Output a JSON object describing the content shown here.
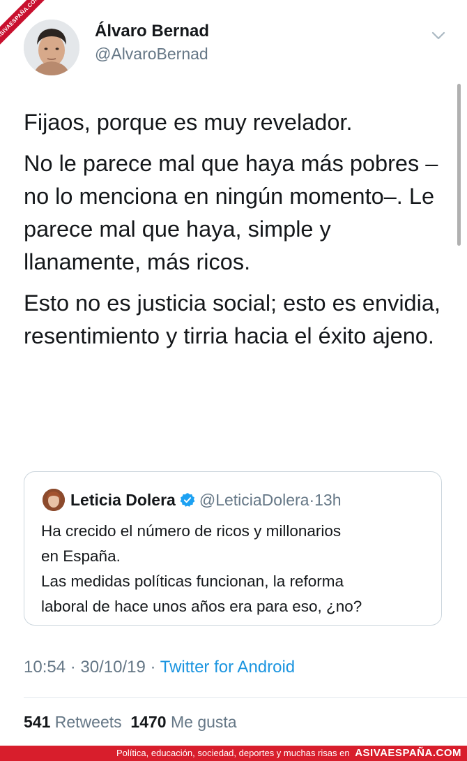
{
  "watermark": {
    "corner_text": "ASIVAESPAÑA.COM"
  },
  "tweet": {
    "author_name": "Álvaro Bernad",
    "author_handle": "@AlvaroBernad",
    "menu_icon": "chevron-down-icon",
    "paragraphs": [
      "Fijaos, porque es muy revelador.",
      "No le parece mal que haya más pobres – no lo menciona en ningún momento–. Le parece mal que haya, simple y llanamente, más ricos.",
      "Esto no es justicia social; esto es envidia, resentimiento y tirria hacia el éxito ajeno."
    ],
    "time": "10:54",
    "date": "30/10/19",
    "separator": "·",
    "source": "Twitter for Android",
    "retweets_count": "541",
    "retweets_label": "Retweets",
    "likes_count": "1470",
    "likes_label": "Me gusta"
  },
  "quoted": {
    "name": "Leticia Dolera",
    "verified_icon": "verified-badge-icon",
    "handle": "@LeticiaDolera",
    "separator": "·",
    "time": "13h",
    "lines": [
      "Ha crecido el número de ricos y  millonarios",
      "en España.",
      "Las medidas políticas funcionan, la reforma",
      "laboral de hace unos años era para eso, ¿no?"
    ]
  },
  "footer": {
    "tagline": "Política, educación, sociedad, deportes y muchas risas en",
    "site": "ASIVAESPAÑA.COM"
  },
  "colors": {
    "text": "#14171a",
    "secondary": "#657786",
    "link": "#1b95e0",
    "verified": "#1da1f2",
    "banner": "#d81e2c"
  }
}
